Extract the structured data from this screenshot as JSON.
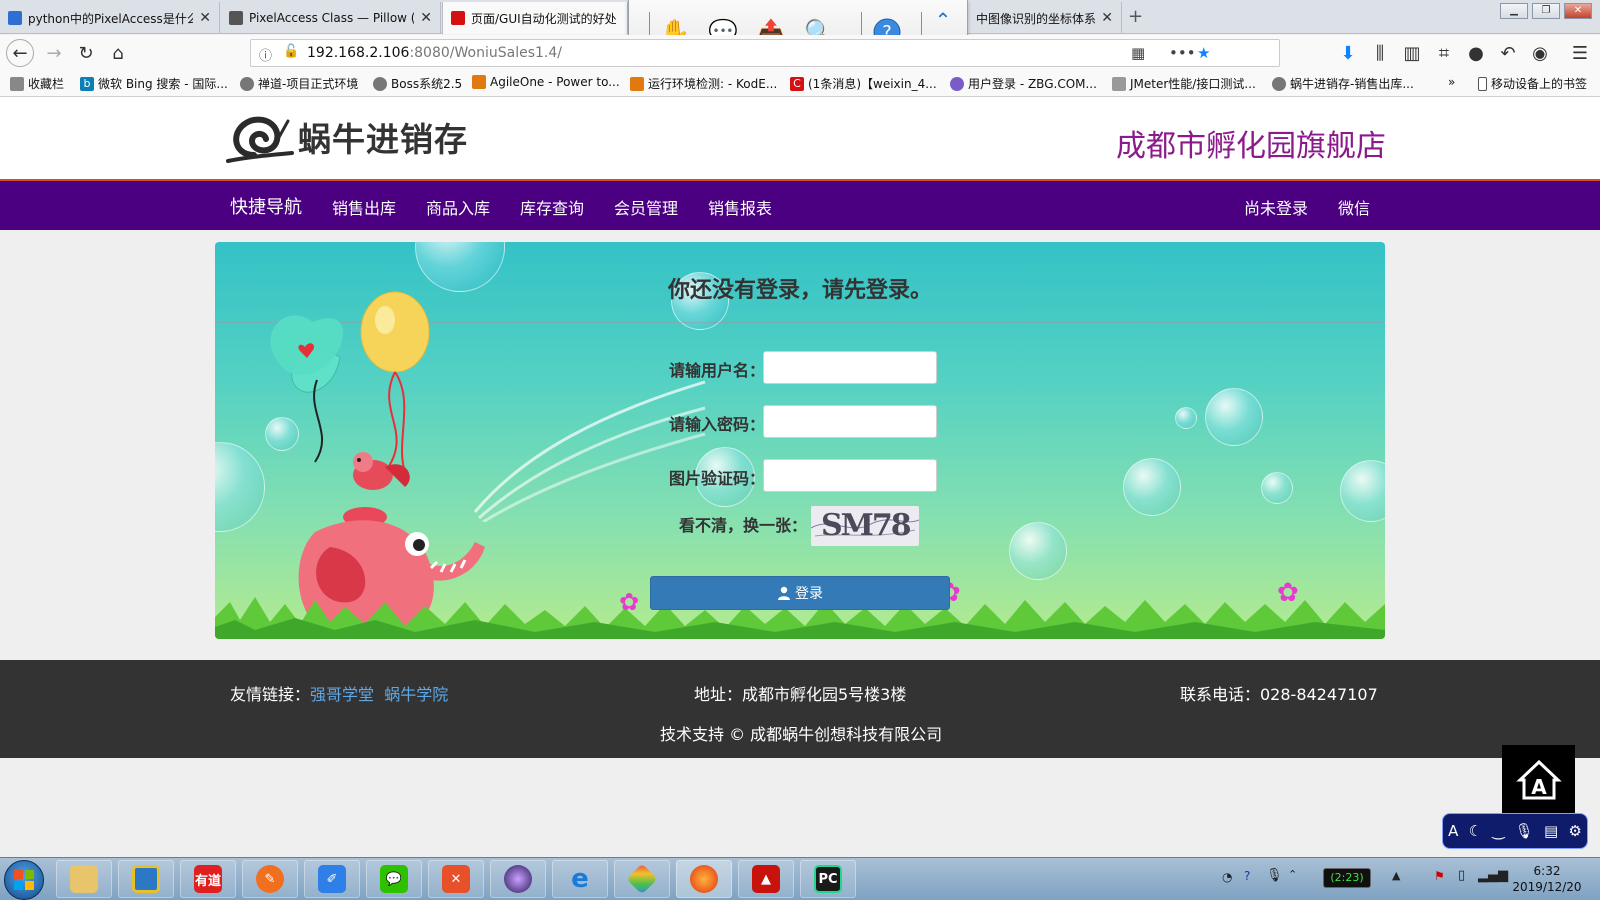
{
  "browser": {
    "tabs": [
      {
        "title": "python中的PixelAccess是什么",
        "favicon_color": "#2f6fd1"
      },
      {
        "title": "PixelAccess Class — Pillow (P",
        "favicon_color": "#555555"
      },
      {
        "title": "页面/GUI自动化测试的好处",
        "favicon_color": "#d41010"
      },
      {
        "title": "中图像识别的坐标体系",
        "favicon_color": "#3a7bd5"
      }
    ],
    "new_tab": "+",
    "url_host": "192.168.2.106",
    "url_path": ":8080/WoniuSales1.4/",
    "bookmarks": [
      "收藏栏",
      "微软 Bing 搜索 - 国际...",
      "禅道-项目正式环境",
      "Boss系统2.5",
      "AgileOne - Power to...",
      "运行环境检测: - KodE...",
      "(1条消息)【weixin_4...",
      "用户登录 - ZBG.COM...",
      "JMeter性能/接口测试...",
      "蜗牛进销存-销售出库...",
      "移动设备上的书签"
    ]
  },
  "site": {
    "logo_text": "蜗牛进销存",
    "store_name": "成都市孵化园旗舰店",
    "nav": {
      "brand": "快捷导航",
      "items": [
        "销售出库",
        "商品入库",
        "库存查询",
        "会员管理",
        "销售报表"
      ],
      "right": [
        "尚未登录",
        "微信"
      ]
    },
    "login": {
      "title": "你还没有登录，请先登录。",
      "username_label": "请输用户名：",
      "password_label": "请输入密码：",
      "captcha_label": "图片验证码：",
      "refresh_label": "看不清，换一张：",
      "captcha_text": "SM78",
      "button_label": "登录",
      "username_value": "",
      "password_value": "",
      "captcha_value": ""
    },
    "footer": {
      "links_label": "友情链接：",
      "links": [
        "强哥学堂",
        "蜗牛学院"
      ],
      "address": "地址：成都市孵化园5号楼3楼",
      "phone": "联系电话：028-84247107",
      "support": "技术支持 © 成都蜗牛创想科技有限公司"
    }
  },
  "colors": {
    "nav_bg": "#4b0082",
    "store_name": "#8b1a8b",
    "login_button": "#337ab7",
    "footer_bg": "#333333",
    "footer_link": "#5fa8e8"
  },
  "taskbar": {
    "apps": [
      "file-explorer",
      "window-app",
      "youdao",
      "pen-app",
      "edit-app",
      "wechat",
      "xmind",
      "galaxy-app",
      "ie",
      "paint-app",
      "firefox",
      "acrobat",
      "pycharm"
    ],
    "youdao_label": "有道",
    "pycharm_label": "PC",
    "battery": "(2:23)",
    "time": "6:32",
    "date": "2019/12/20"
  }
}
